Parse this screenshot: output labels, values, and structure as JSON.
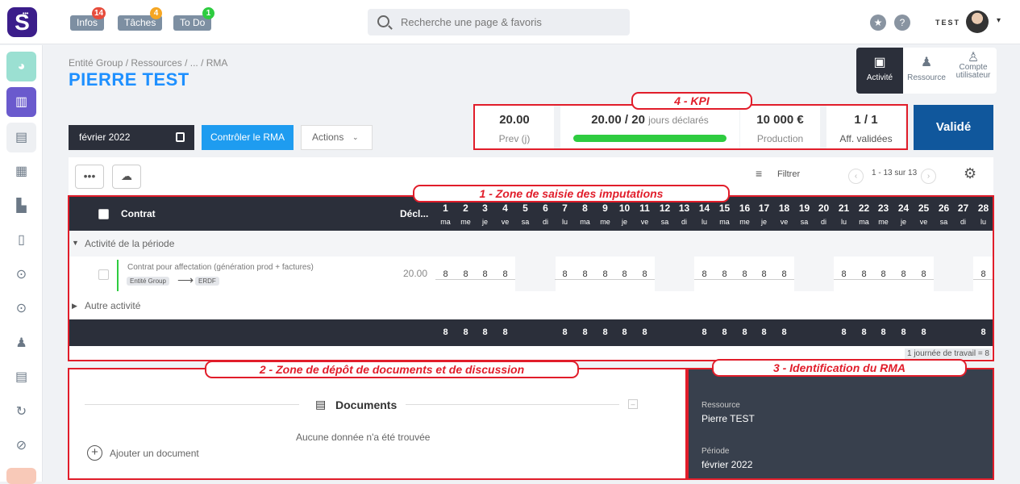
{
  "logo": "S",
  "topbar": {
    "tags": [
      {
        "label": "Infos",
        "badge": "14",
        "color": "#e74c3c"
      },
      {
        "label": "Tâches",
        "badge": "4",
        "color": "#f5a623"
      },
      {
        "label": "To Do",
        "badge": "1",
        "color": "#2ecc40"
      }
    ],
    "search_placeholder": "Recherche une page & favoris",
    "star": "★",
    "help": "?",
    "user": "TEST",
    "caret": "▾"
  },
  "breadcrumb": "Entité Group  /  Ressources  /  ...  /  RMA",
  "page_title": "PIERRE TEST",
  "right_tabs": [
    {
      "label": "Activité",
      "icon": "chart-doc-icon"
    },
    {
      "label": "Ressource",
      "icon": "person-icon"
    },
    {
      "label": "Compte utilisateur",
      "icon": "user-icon"
    }
  ],
  "kpi": {
    "prev_value": "20.00",
    "prev_label": "Prev (j)",
    "jours_value": "20.00 / 20",
    "jours_label": "jours déclarés",
    "jours_progress": 1.0,
    "prod_value": "10 000 €",
    "prod_label": "Production",
    "aff_value": "1 / 1",
    "aff_label": "Aff. validées",
    "status": "Validé"
  },
  "controls": {
    "month": "février 2022",
    "control_btn": "Contrôler le RMA",
    "actions": "Actions"
  },
  "toolbar": {
    "more": "•••",
    "filter": "Filtrer",
    "pager": "1 - 13 sur 13",
    "prev": "‹",
    "next": "›"
  },
  "grid": {
    "col_contrat": "Contrat",
    "col_decl": "Décl...",
    "days": [
      {
        "n": "1",
        "d": "ma",
        "v": "8",
        "we": false
      },
      {
        "n": "2",
        "d": "me",
        "v": "8",
        "we": false
      },
      {
        "n": "3",
        "d": "je",
        "v": "8",
        "we": false
      },
      {
        "n": "4",
        "d": "ve",
        "v": "8",
        "we": false
      },
      {
        "n": "5",
        "d": "sa",
        "v": "",
        "we": true
      },
      {
        "n": "6",
        "d": "di",
        "v": "",
        "we": true
      },
      {
        "n": "7",
        "d": "lu",
        "v": "8",
        "we": false
      },
      {
        "n": "8",
        "d": "ma",
        "v": "8",
        "we": false
      },
      {
        "n": "9",
        "d": "me",
        "v": "8",
        "we": false
      },
      {
        "n": "10",
        "d": "je",
        "v": "8",
        "we": false
      },
      {
        "n": "11",
        "d": "ve",
        "v": "8",
        "we": false
      },
      {
        "n": "12",
        "d": "sa",
        "v": "",
        "we": true
      },
      {
        "n": "13",
        "d": "di",
        "v": "",
        "we": true
      },
      {
        "n": "14",
        "d": "lu",
        "v": "8",
        "we": false
      },
      {
        "n": "15",
        "d": "ma",
        "v": "8",
        "we": false
      },
      {
        "n": "16",
        "d": "me",
        "v": "8",
        "we": false
      },
      {
        "n": "17",
        "d": "je",
        "v": "8",
        "we": false
      },
      {
        "n": "18",
        "d": "ve",
        "v": "8",
        "we": false
      },
      {
        "n": "19",
        "d": "sa",
        "v": "",
        "we": true
      },
      {
        "n": "20",
        "d": "di",
        "v": "",
        "we": true
      },
      {
        "n": "21",
        "d": "lu",
        "v": "8",
        "we": false
      },
      {
        "n": "22",
        "d": "ma",
        "v": "8",
        "we": false
      },
      {
        "n": "23",
        "d": "me",
        "v": "8",
        "we": false
      },
      {
        "n": "24",
        "d": "je",
        "v": "8",
        "we": false
      },
      {
        "n": "25",
        "d": "ve",
        "v": "8",
        "we": false
      },
      {
        "n": "26",
        "d": "sa",
        "v": "",
        "we": true
      },
      {
        "n": "27",
        "d": "di",
        "v": "",
        "we": true
      },
      {
        "n": "28",
        "d": "lu",
        "v": "8",
        "we": false
      }
    ],
    "group1": "Activité de la période",
    "contract_title": "Contrat pour affectation (génération prod + factures)",
    "tag_from": "Entité Group",
    "tag_to": "ERDF",
    "arrow": "⟶",
    "contract_total": "20.00",
    "group2": "Autre activité",
    "hint": "1 journée de travail = 8"
  },
  "docs": {
    "title": "Documents",
    "empty": "Aucune donnée n'a été trouvée",
    "add": "Ajouter un document",
    "collapse": "–",
    "plus": "+"
  },
  "ident": {
    "res_label": "Ressource",
    "res_value": "Pierre TEST",
    "per_label": "Période",
    "per_value": "février 2022"
  },
  "annotations": {
    "zone1": "1   -   Zone de saisie des imputations",
    "zone2": "2   -   Zone de dépôt de documents et de discussion",
    "zone3": "3   -   Identification du RMA",
    "zone4": "4   -   KPI"
  },
  "sidebar_icons": [
    "dashboard-icon",
    "chart-icon",
    "calendar-icon",
    "document-icon",
    "factory-icon",
    "file-icon",
    "euro-circle-icon",
    "euro-circle-icon",
    "person-icon",
    "invoice-icon",
    "cycle-icon",
    "analytics-icon"
  ]
}
